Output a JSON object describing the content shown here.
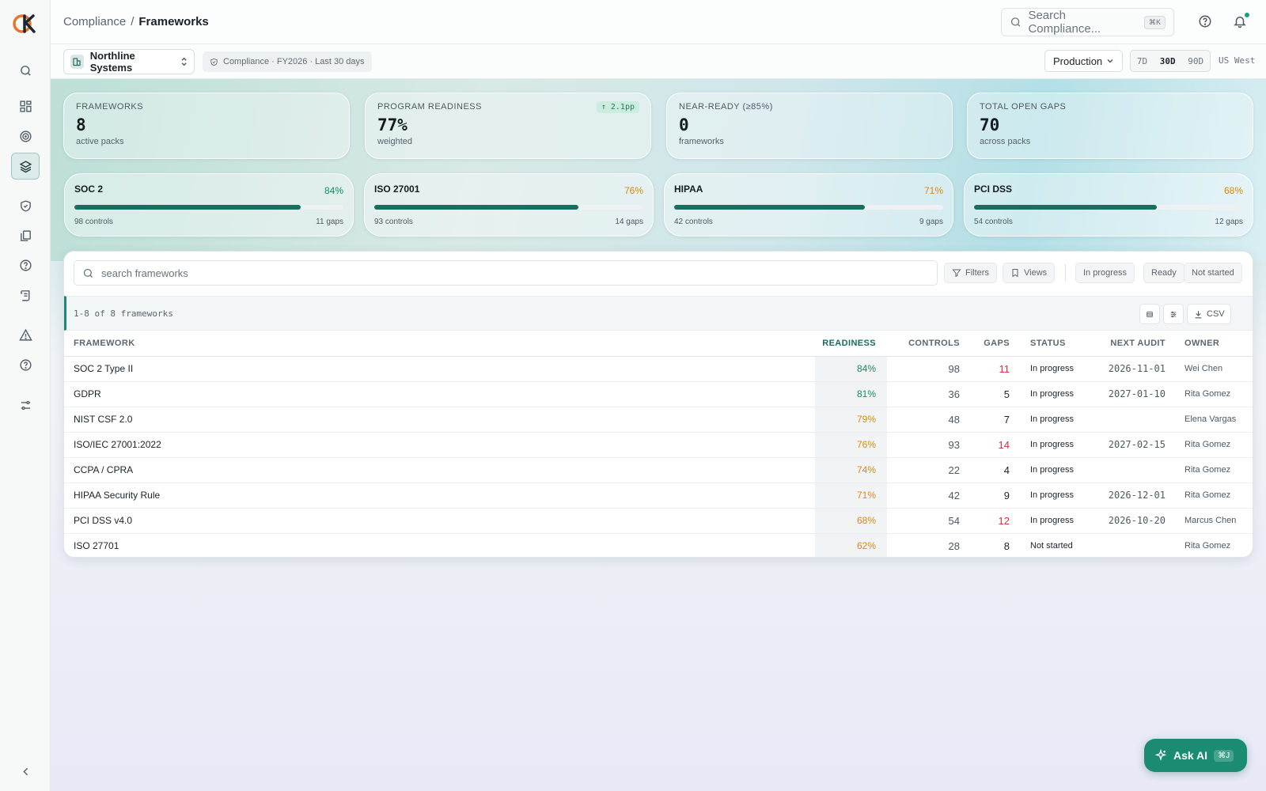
{
  "breadcrumb": {
    "parent": "Compliance",
    "sep": "/",
    "current": "Frameworks"
  },
  "search": {
    "placeholder": "Search Compliance...",
    "shortcut": "⌘K"
  },
  "subheader": {
    "org": "Northline Systems",
    "context": "Compliance · FY2026 · Last 30 days",
    "environment": "Production",
    "ranges": [
      "7D",
      "30D",
      "90D"
    ],
    "active_range": "30D",
    "region": "US West"
  },
  "kpis": [
    {
      "label": "FRAMEWORKS",
      "value": "8",
      "sub": "active packs"
    },
    {
      "label": "PROGRAM READINESS",
      "value": "77%",
      "sub": "weighted",
      "delta": "↑ 2.1pp"
    },
    {
      "label": "NEAR-READY (≥85%)",
      "value": "0",
      "sub": "frameworks"
    },
    {
      "label": "TOTAL OPEN GAPS",
      "value": "70",
      "sub": "across packs"
    }
  ],
  "framework_cards": [
    {
      "name": "SOC 2",
      "pct": "84%",
      "progress": 0.84,
      "controls": "98 controls",
      "gaps": "11 gaps",
      "tone": "green"
    },
    {
      "name": "ISO 27001",
      "pct": "76%",
      "progress": 0.76,
      "controls": "93 controls",
      "gaps": "14 gaps",
      "tone": "orange"
    },
    {
      "name": "HIPAA",
      "pct": "71%",
      "progress": 0.71,
      "controls": "42 controls",
      "gaps": "9 gaps",
      "tone": "orange"
    },
    {
      "name": "PCI DSS",
      "pct": "68%",
      "progress": 0.68,
      "controls": "54 controls",
      "gaps": "12 gaps",
      "tone": "orange"
    }
  ],
  "table_toolbar": {
    "search_placeholder": "search frameworks",
    "filters": "Filters",
    "views": "Views",
    "chips": [
      "In progress",
      "Ready",
      "Not started"
    ],
    "count": "1-8 of 8 frameworks",
    "csv": "CSV"
  },
  "columns": [
    "FRAMEWORK",
    "READINESS",
    "CONTROLS",
    "GAPS",
    "STATUS",
    "NEXT AUDIT",
    "OWNER"
  ],
  "rows": [
    {
      "framework": "SOC 2 Type II",
      "readiness": "84%",
      "tone": "green",
      "controls": "98",
      "gaps": "11",
      "gap_red": true,
      "status": "In progress",
      "next_audit": "2026-11-01",
      "owner": "Wei Chen"
    },
    {
      "framework": "GDPR",
      "readiness": "81%",
      "tone": "green",
      "controls": "36",
      "gaps": "5",
      "gap_red": false,
      "status": "In progress",
      "next_audit": "2027-01-10",
      "owner": "Rita Gomez"
    },
    {
      "framework": "NIST CSF 2.0",
      "readiness": "79%",
      "tone": "orange",
      "controls": "48",
      "gaps": "7",
      "gap_red": false,
      "status": "In progress",
      "next_audit": "",
      "owner": "Elena Vargas"
    },
    {
      "framework": "ISO/IEC 27001:2022",
      "readiness": "76%",
      "tone": "orange",
      "controls": "93",
      "gaps": "14",
      "gap_red": true,
      "status": "In progress",
      "next_audit": "2027-02-15",
      "owner": "Rita Gomez"
    },
    {
      "framework": "CCPA / CPRA",
      "readiness": "74%",
      "tone": "orange",
      "controls": "22",
      "gaps": "4",
      "gap_red": false,
      "status": "In progress",
      "next_audit": "",
      "owner": "Rita Gomez"
    },
    {
      "framework": "HIPAA Security Rule",
      "readiness": "71%",
      "tone": "orange",
      "controls": "42",
      "gaps": "9",
      "gap_red": false,
      "status": "In progress",
      "next_audit": "2026-12-01",
      "owner": "Rita Gomez"
    },
    {
      "framework": "PCI DSS v4.0",
      "readiness": "68%",
      "tone": "orange",
      "controls": "54",
      "gaps": "12",
      "gap_red": true,
      "status": "In progress",
      "next_audit": "2026-10-20",
      "owner": "Marcus Chen"
    },
    {
      "framework": "ISO 27701",
      "readiness": "62%",
      "tone": "orange",
      "controls": "28",
      "gaps": "8",
      "gap_red": false,
      "status": "Not started",
      "next_audit": "",
      "owner": "Rita Gomez"
    }
  ],
  "ask_ai": {
    "label": "Ask AI",
    "shortcut": "⌘J"
  },
  "colors": {
    "accent": "#1b8c71",
    "ready_green": "#1a8a5f",
    "warn_orange": "#d98a10",
    "gap_red": "#d8303f",
    "progress": "#17705f"
  }
}
